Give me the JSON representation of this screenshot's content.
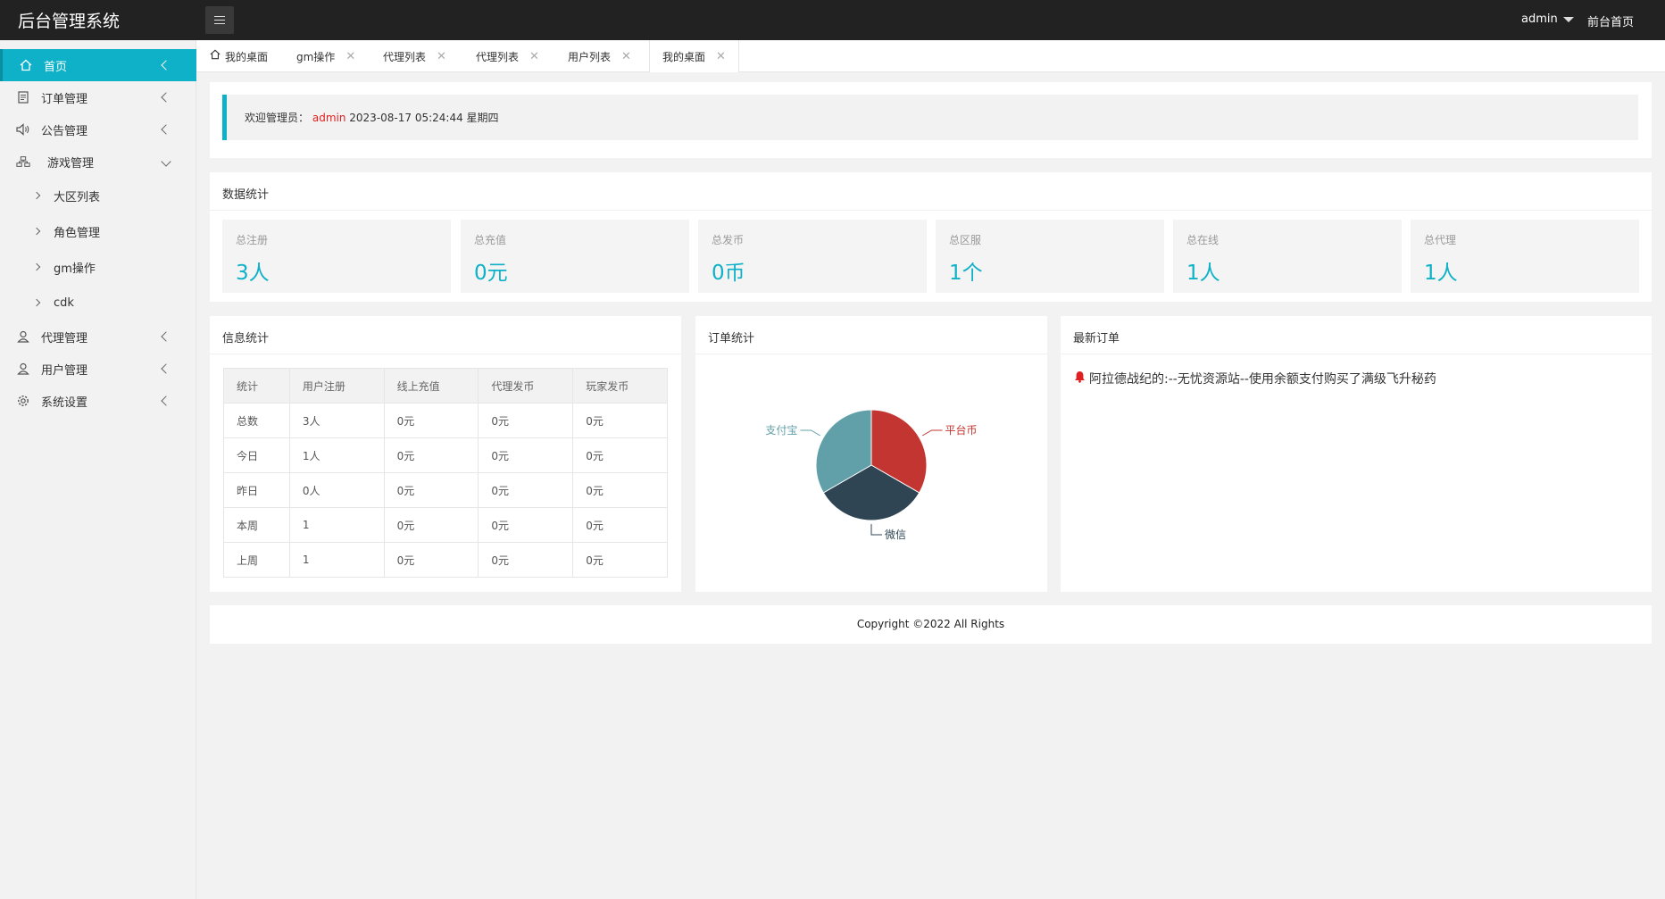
{
  "header": {
    "app_title": "后台管理系统",
    "user": "admin",
    "front_link": "前台首页"
  },
  "sidebar": {
    "items": [
      {
        "label": "首页",
        "icon": "home-icon"
      },
      {
        "label": "订单管理",
        "icon": "order-icon"
      },
      {
        "label": "公告管理",
        "icon": "speaker-icon"
      },
      {
        "label": "游戏管理",
        "icon": "sitemap-icon"
      },
      {
        "label": "代理管理",
        "icon": "user-icon"
      },
      {
        "label": "用户管理",
        "icon": "user-icon"
      },
      {
        "label": "系统设置",
        "icon": "gear-icon"
      }
    ],
    "game_sub": [
      "大区列表",
      "角色管理",
      "gm操作",
      "cdk"
    ]
  },
  "tabs": [
    {
      "label": "我的桌面",
      "home": true,
      "closable": false
    },
    {
      "label": "gm操作"
    },
    {
      "label": "代理列表"
    },
    {
      "label": "代理列表"
    },
    {
      "label": "用户列表"
    },
    {
      "label": "我的桌面",
      "active": true
    }
  ],
  "welcome": {
    "prefix": "欢迎管理员：",
    "user": "admin",
    "datetime": "2023-08-17  05:24:44  星期四"
  },
  "stats": {
    "title": "数据统计",
    "boxes": [
      {
        "label": "总注册",
        "value": "3人"
      },
      {
        "label": "总充值",
        "value": "0元"
      },
      {
        "label": "总发币",
        "value": "0币"
      },
      {
        "label": "总区服",
        "value": "1个"
      },
      {
        "label": "总在线",
        "value": "1人"
      },
      {
        "label": "总代理",
        "value": "1人"
      }
    ]
  },
  "info": {
    "title": "信息统计",
    "headers": [
      "统计",
      "用户注册",
      "线上充值",
      "代理发币",
      "玩家发币"
    ],
    "rows": [
      [
        "总数",
        "3人",
        "0元",
        "0元",
        "0元"
      ],
      [
        "今日",
        "1人",
        "0元",
        "0元",
        "0元"
      ],
      [
        "昨日",
        "0人",
        "0元",
        "0元",
        "0元"
      ],
      [
        "本周",
        "1",
        "0元",
        "0元",
        "0元"
      ],
      [
        "上周",
        "1",
        "0元",
        "0元",
        "0元"
      ]
    ]
  },
  "orders": {
    "title": "订单统计"
  },
  "chart_data": {
    "type": "pie",
    "title": "",
    "slices": [
      {
        "label": "平台币",
        "value": 1,
        "color": "#c23531"
      },
      {
        "label": "微信",
        "value": 1,
        "color": "#2f4554"
      },
      {
        "label": "支付宝",
        "value": 1,
        "color": "#61a0a8"
      }
    ]
  },
  "latest": {
    "title": "最新订单",
    "items": [
      "阿拉德战纪的:--无忧资源站--使用余额支付购买了满级飞升秘药"
    ]
  },
  "footer": {
    "text": "Copyright ©2022 All Rights"
  },
  "colors": {
    "accent": "#0eb1c7",
    "topbar": "#222222"
  }
}
